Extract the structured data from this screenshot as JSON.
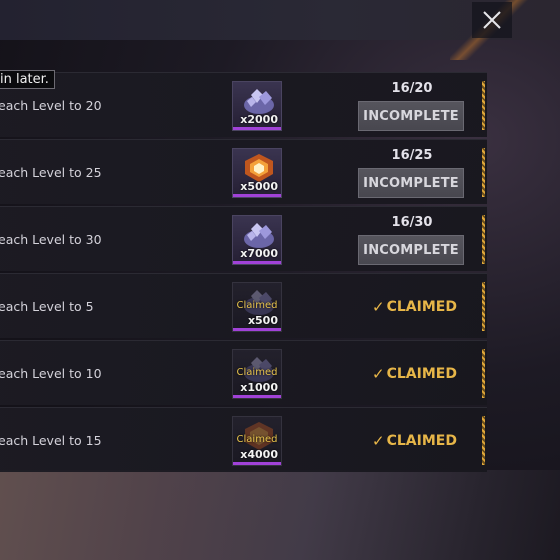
{
  "tooltip": {
    "text": "in later."
  },
  "close": {
    "icon": "close-icon"
  },
  "colors": {
    "claimed": "#e7b648",
    "rarity_bar": "#a142d8",
    "stripe": "#e0a73a"
  },
  "missions": [
    {
      "task": "each Level to 20",
      "reward_icon": "diamond-pile-icon",
      "reward_qty": "x2000",
      "progress": "16/20",
      "status": "INCOMPLETE",
      "claimed": false
    },
    {
      "task": "each Level to 25",
      "reward_icon": "crate-badge-icon",
      "reward_qty": "x5000",
      "progress": "16/25",
      "status": "INCOMPLETE",
      "claimed": false
    },
    {
      "task": "each Level to 30",
      "reward_icon": "diamond-pile-icon",
      "reward_qty": "x7000",
      "progress": "16/30",
      "status": "INCOMPLETE",
      "claimed": false
    },
    {
      "task": "each Level to 5",
      "reward_icon": "diamond-pile-icon",
      "reward_qty": "x500",
      "reward_tag": "Claimed",
      "status": "CLAIMED",
      "claimed": true
    },
    {
      "task": "each Level to 10",
      "reward_icon": "diamond-pile-icon",
      "reward_qty": "x1000",
      "reward_tag": "Claimed",
      "status": "CLAIMED",
      "claimed": true
    },
    {
      "task": "each Level to 15",
      "reward_icon": "crate-badge-icon",
      "reward_qty": "x4000",
      "reward_tag": "Claimed",
      "status": "CLAIMED",
      "claimed": true
    }
  ]
}
